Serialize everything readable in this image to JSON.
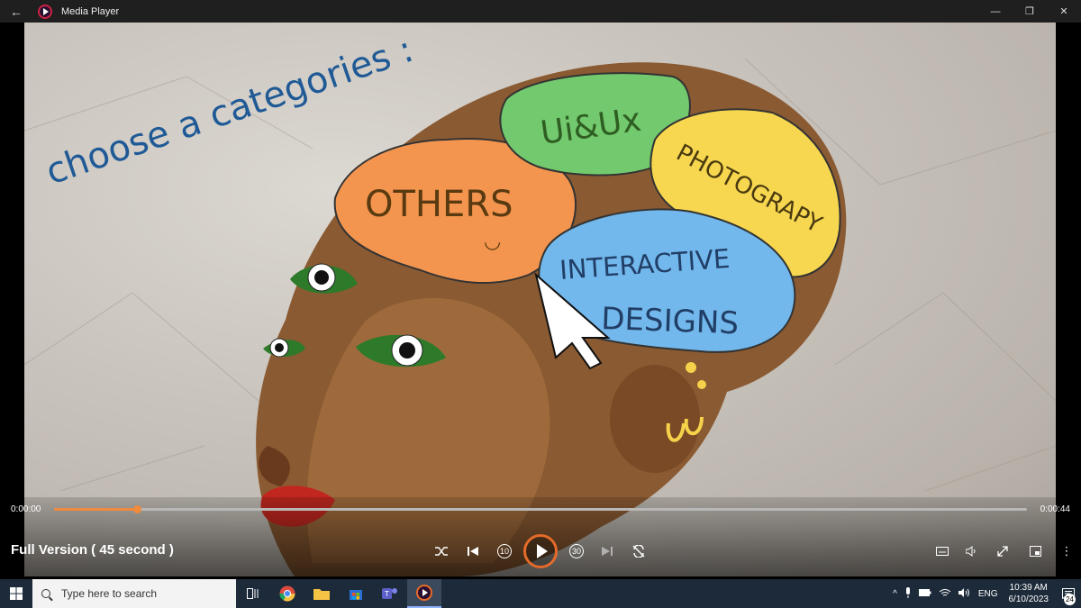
{
  "window": {
    "title": "Media Player",
    "back_glyph": "←",
    "minimize_glyph": "—",
    "restore_glyph": "❐",
    "close_glyph": "✕"
  },
  "video": {
    "heading": "choose a categories :",
    "categories": [
      {
        "label": "OTHERS",
        "color": "#f4954f"
      },
      {
        "label": "Ui&Ux",
        "color": "#72c96e"
      },
      {
        "label": "PHOTOGRAPY",
        "color": "#f7d74f"
      },
      {
        "label": "INTERACTIVE",
        "color": "#72b8ec"
      },
      {
        "label": "DESIGNS",
        "color": "#72b8ec"
      }
    ],
    "smiley": "◡"
  },
  "player": {
    "current_time": "0:00:00",
    "total_time": "0:00:44",
    "progress": 0.085,
    "media_title": "Full Version ( 45 second )",
    "accent_color": "#e56b2a",
    "icons": [
      "shuffle-icon",
      "previous-icon",
      "rewind-10-icon",
      "play-icon",
      "forward-30-icon",
      "next-icon",
      "repeat-off-icon",
      "subtitles-icon",
      "volume-icon",
      "fullscreen-icon",
      "mini-player-icon",
      "more-icon"
    ],
    "rewind_label": "10",
    "forward_label": "30",
    "more_glyph": "⋮"
  },
  "taskbar": {
    "search_placeholder": "Type here to search",
    "language": "ENG",
    "time": "10:39 AM",
    "date": "6/10/2023",
    "notification_count": "24",
    "tray_chevron": "^"
  }
}
